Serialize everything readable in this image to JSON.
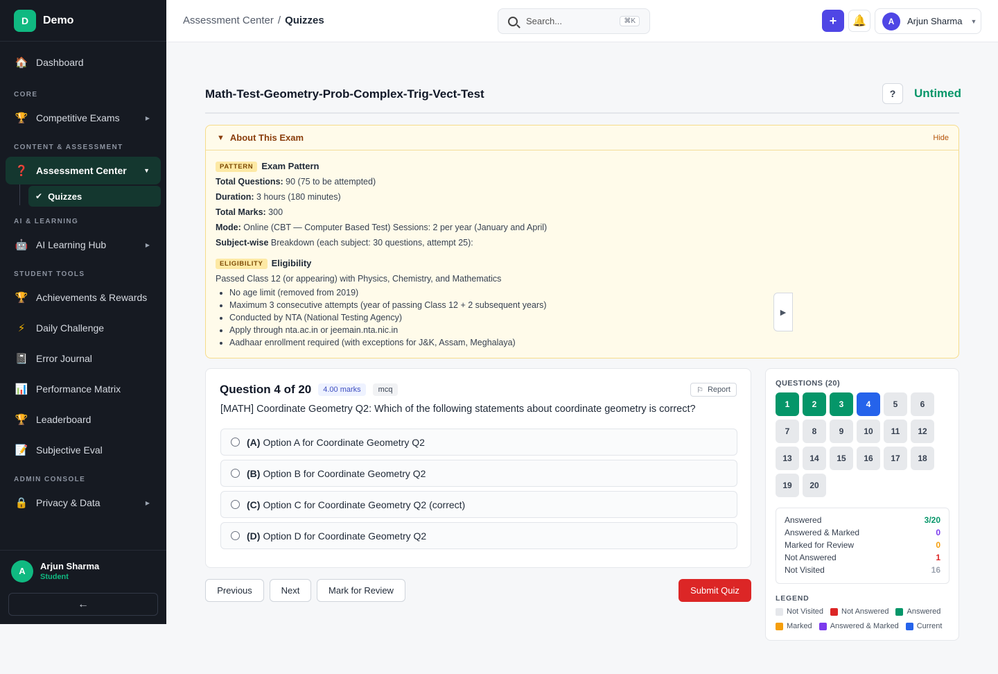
{
  "brand": {
    "logo_letter": "D",
    "name": "Demo"
  },
  "sidebar": {
    "dashboard": "Dashboard",
    "sections": {
      "core": "CORE",
      "content": "CONTENT & ASSESSMENT",
      "ai": "AI & LEARNING",
      "student": "STUDENT TOOLS",
      "admin": "ADMIN CONSOLE"
    },
    "items": {
      "competitive_exams": "Competitive Exams",
      "assessment_center": "Assessment Center",
      "quizzes": "Quizzes",
      "ai_learning_hub": "AI Learning Hub",
      "achievements": "Achievements & Rewards",
      "daily_challenge": "Daily Challenge",
      "error_journal": "Error Journal",
      "performance_matrix": "Performance Matrix",
      "leaderboard": "Leaderboard",
      "subjective_eval": "Subjective Eval",
      "privacy": "Privacy & Data"
    },
    "user": {
      "initial": "A",
      "name": "Arjun Sharma",
      "role": "Student"
    },
    "collapse_glyph": "←"
  },
  "topbar": {
    "breadcrumb": {
      "parent": "Assessment Center",
      "sep": "/",
      "current": "Quizzes"
    },
    "search": {
      "placeholder": "Search...",
      "shortcut": "⌘K"
    },
    "plus_glyph": "+",
    "user": {
      "initial": "A",
      "name": "Arjun Sharma"
    }
  },
  "quiz": {
    "title": "Math-Test-Geometry-Prob-Complex-Trig-Vect-Test",
    "help": "?",
    "timer": "Untimed"
  },
  "about": {
    "heading": "About This Exam",
    "hide": "Hide",
    "pattern_tag": "PATTERN",
    "pattern_title": "Exam Pattern",
    "lines": [
      {
        "k": "Total Questions:",
        "v": " 90 (75 to be attempted)"
      },
      {
        "k": "Duration:",
        "v": " 3 hours (180 minutes)"
      },
      {
        "k": "Total Marks:",
        "v": " 300"
      },
      {
        "k": "Mode:",
        "v": " Online (CBT — Computer Based Test) Sessions: 2 per year (January and April)"
      },
      {
        "k": "Subject-wise",
        "v": " Breakdown (each subject: 30 questions, attempt 25):"
      }
    ],
    "eligibility_tag": "ELIGIBILITY",
    "eligibility_title": "Eligibility",
    "eligibility_intro": "Passed Class 12 (or appearing) with Physics, Chemistry, and Mathematics",
    "bullets": [
      "No age limit (removed from 2019)",
      "Maximum 3 consecutive attempts (year of passing Class 12 + 2 subsequent years)",
      "Conducted by NTA (National Testing Agency)",
      "Apply through nta.ac.in or jeemain.nta.nic.in",
      "Aadhaar enrollment required (with exceptions for J&K, Assam, Meghalaya)"
    ]
  },
  "question": {
    "number_label": "Question 4 of 20",
    "marks": "4.00 marks",
    "type": "mcq",
    "report": "Report",
    "text": "[MATH] Coordinate Geometry Q2: Which of the following statements about coordinate geometry is correct?",
    "options": [
      {
        "label": "(A)",
        "text": "Option A for Coordinate Geometry Q2"
      },
      {
        "label": "(B)",
        "text": "Option B for Coordinate Geometry Q2"
      },
      {
        "label": "(C)",
        "text": "Option C for Coordinate Geometry Q2 (correct)"
      },
      {
        "label": "(D)",
        "text": "Option D for Coordinate Geometry Q2"
      }
    ]
  },
  "buttons": {
    "previous": "Previous",
    "next": "Next",
    "mark": "Mark for Review",
    "submit": "Submit Quiz"
  },
  "palette": {
    "title": "QUESTIONS (20)",
    "questions": [
      {
        "n": "1",
        "status": "answered"
      },
      {
        "n": "2",
        "status": "answered"
      },
      {
        "n": "3",
        "status": "answered"
      },
      {
        "n": "4",
        "status": "current"
      },
      {
        "n": "5",
        "status": "not-visited"
      },
      {
        "n": "6",
        "status": "not-visited"
      },
      {
        "n": "7",
        "status": "not-visited"
      },
      {
        "n": "8",
        "status": "not-visited"
      },
      {
        "n": "9",
        "status": "not-visited"
      },
      {
        "n": "10",
        "status": "not-visited"
      },
      {
        "n": "11",
        "status": "not-visited"
      },
      {
        "n": "12",
        "status": "not-visited"
      },
      {
        "n": "13",
        "status": "not-visited"
      },
      {
        "n": "14",
        "status": "not-visited"
      },
      {
        "n": "15",
        "status": "not-visited"
      },
      {
        "n": "16",
        "status": "not-visited"
      },
      {
        "n": "17",
        "status": "not-visited"
      },
      {
        "n": "18",
        "status": "not-visited"
      },
      {
        "n": "19",
        "status": "not-visited"
      },
      {
        "n": "20",
        "status": "not-visited"
      }
    ],
    "stats": [
      {
        "label": "Answered",
        "value": "3/20",
        "color": "#059669"
      },
      {
        "label": "Answered & Marked",
        "value": "0",
        "color": "#7c3aed"
      },
      {
        "label": "Marked for Review",
        "value": "0",
        "color": "#f59e0b"
      },
      {
        "label": "Not Answered",
        "value": "1",
        "color": "#dc2626"
      },
      {
        "label": "Not Visited",
        "value": "16",
        "color": "#9ca3af"
      }
    ],
    "legend_title": "LEGEND",
    "legend": [
      {
        "label": "Not Visited",
        "color": "#e5e7eb"
      },
      {
        "label": "Not Answered",
        "color": "#dc2626"
      },
      {
        "label": "Answered",
        "color": "#059669"
      },
      {
        "label": "Marked",
        "color": "#f59e0b"
      },
      {
        "label": "Answered & Marked",
        "color": "#7c3aed"
      },
      {
        "label": "Current",
        "color": "#2563eb"
      }
    ]
  }
}
